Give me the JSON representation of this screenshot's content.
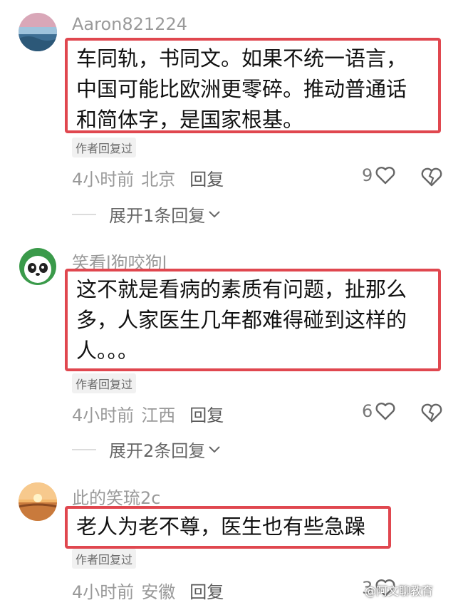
{
  "comments": [
    {
      "username": "Aaron821224",
      "lines": [
        "车同轨，书同文。如果不统一语言，",
        "中国可能比欧洲更零碎。推动普通话",
        "和简体字，是国家根基。"
      ],
      "author_tag": "作者回复过",
      "time": "4小时前",
      "location": "北京",
      "reply_label": "回复",
      "likes": "9",
      "expand_label": "展开1条回复"
    },
    {
      "username": "笑看l狗咬狗l",
      "lines": [
        "这不就是看病的素质有问题，扯那么",
        "多，人家医生几年都难得碰到这样的",
        "人。。。"
      ],
      "author_tag": "作者回复过",
      "time": "4小时前",
      "location": "江西",
      "reply_label": "回复",
      "likes": "6",
      "expand_label": "展开2条回复"
    },
    {
      "username": "此的笑琉2c",
      "lines": [
        "老人为老不尊，医生也有些急躁"
      ],
      "author_tag": "作者回复过",
      "time": "4小时前",
      "location": "安徽",
      "reply_label": "回复",
      "likes": "3"
    }
  ],
  "watermark": "@阿文聊教育",
  "colors": {
    "highlight_border": "#e0474f",
    "muted_text": "#999999"
  },
  "icons": {
    "like": "heart-outline-icon",
    "dislike": "broken-heart-icon",
    "expand": "chevron-down-icon"
  }
}
